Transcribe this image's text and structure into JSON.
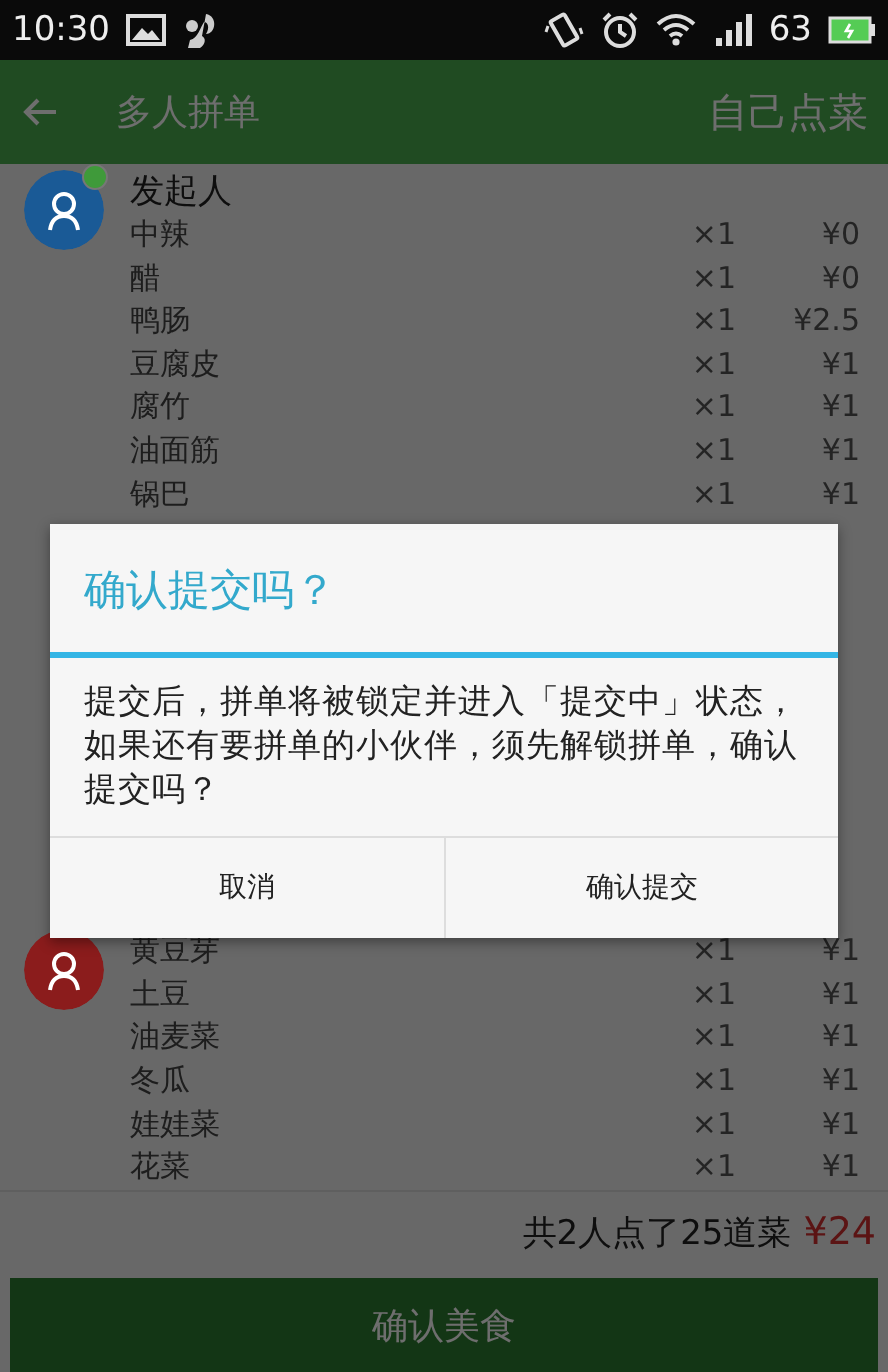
{
  "status_bar": {
    "time": "10:30",
    "battery": "63"
  },
  "app_bar": {
    "title": "多人拼单",
    "action": "自己点菜"
  },
  "groups": [
    {
      "label": "发起人",
      "color": "#1a5a96",
      "online": true,
      "items": [
        {
          "name": "中辣",
          "qty": "×1",
          "price": "¥0"
        },
        {
          "name": "醋",
          "qty": "×1",
          "price": "¥0"
        },
        {
          "name": "鸭肠",
          "qty": "×1",
          "price": "¥2.5"
        },
        {
          "name": "豆腐皮",
          "qty": "×1",
          "price": "¥1"
        },
        {
          "name": "腐竹",
          "qty": "×1",
          "price": "¥1"
        },
        {
          "name": "油面筋",
          "qty": "×1",
          "price": "¥1"
        },
        {
          "name": "锅巴",
          "qty": "×1",
          "price": "¥1"
        }
      ]
    },
    {
      "color": "#8b1c1c",
      "items": [
        {
          "name": "黄豆芽",
          "qty": "×1",
          "price": "¥1"
        },
        {
          "name": "土豆",
          "qty": "×1",
          "price": "¥1"
        },
        {
          "name": "油麦菜",
          "qty": "×1",
          "price": "¥1"
        },
        {
          "name": "冬瓜",
          "qty": "×1",
          "price": "¥1"
        },
        {
          "name": "娃娃菜",
          "qty": "×1",
          "price": "¥1"
        },
        {
          "name": "花菜",
          "qty": "×1",
          "price": "¥1"
        }
      ]
    }
  ],
  "summary": {
    "text": "共2人点了25道菜",
    "total": "¥24"
  },
  "confirm_button": "确认美食",
  "dialog": {
    "title": "确认提交吗？",
    "message": "提交后，拼单将被锁定并进入「提交中」状态，如果还有要拼单的小伙伴，须先解锁拼单，确认提交吗？",
    "buttons": [
      "取消",
      "确认提交"
    ]
  }
}
